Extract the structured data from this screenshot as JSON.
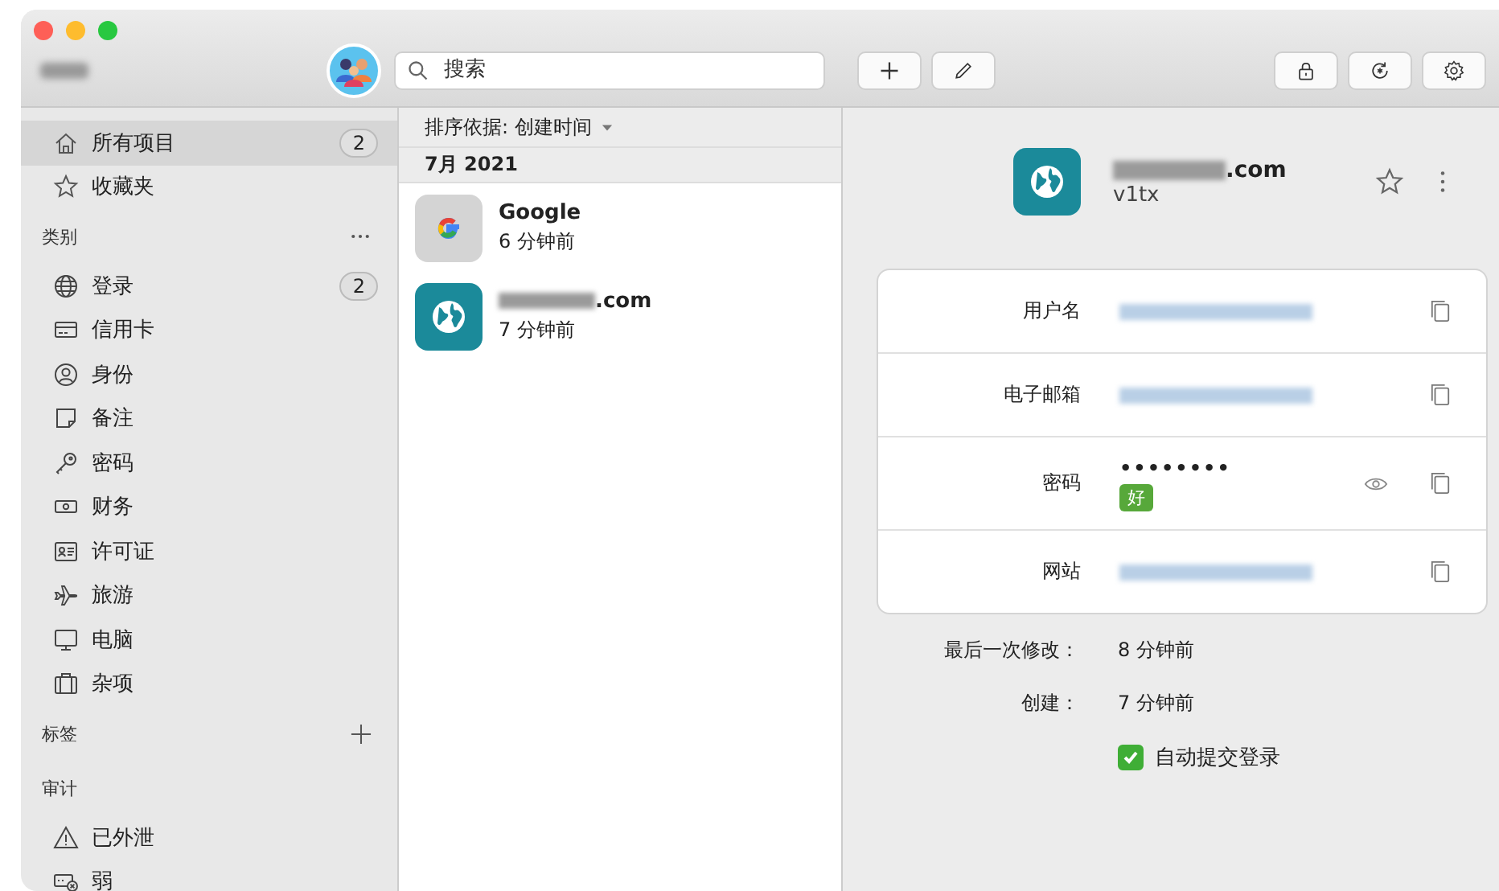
{
  "toolbar": {
    "search": {
      "placeholder": "搜索"
    }
  },
  "sidebar": {
    "items": [
      {
        "label": "所有项目",
        "count": "2",
        "selected": true
      },
      {
        "label": "收藏夹",
        "selected": false
      }
    ],
    "categories_title": "类别",
    "categories": [
      {
        "label": "登录",
        "count": "2",
        "selected": false
      },
      {
        "label": "信用卡",
        "selected": false
      },
      {
        "label": "身份",
        "selected": false
      },
      {
        "label": "备注",
        "selected": false
      },
      {
        "label": "密码",
        "selected": false
      },
      {
        "label": "财务",
        "selected": false
      },
      {
        "label": "许可证",
        "selected": false
      },
      {
        "label": "旅游",
        "selected": false
      },
      {
        "label": "电脑",
        "selected": false
      },
      {
        "label": "杂项",
        "selected": false
      }
    ],
    "tags_title": "标签",
    "audit_title": "审计",
    "audit": [
      {
        "label": "已外泄",
        "selected": false
      },
      {
        "label": "弱",
        "selected": false
      }
    ]
  },
  "list": {
    "sort_label": "排序依据: 创建时间",
    "group": "7月 2021",
    "items": [
      {
        "kind": "google",
        "title": "Google",
        "subtitle": "6 分钟前",
        "redacted": false
      },
      {
        "kind": "web",
        "title": ".com",
        "subtitle": "7 分钟前",
        "redacted": true
      }
    ]
  },
  "detail": {
    "title": ".com",
    "subtitle": "v1tx",
    "favorite": false,
    "fields": [
      {
        "kind": "plain",
        "label": "用户名"
      },
      {
        "kind": "plain",
        "label": "电子邮箱"
      },
      {
        "kind": "password",
        "label": "密码",
        "value": "••••••••",
        "strength": "好"
      },
      {
        "kind": "plain",
        "label": "网站"
      }
    ],
    "meta": [
      {
        "label": "最后一次修改：",
        "value": "8 分钟前"
      },
      {
        "label": "创建：",
        "value": "7 分钟前"
      }
    ],
    "auto_submit": {
      "label": "自动提交登录",
      "checked": true
    }
  }
}
